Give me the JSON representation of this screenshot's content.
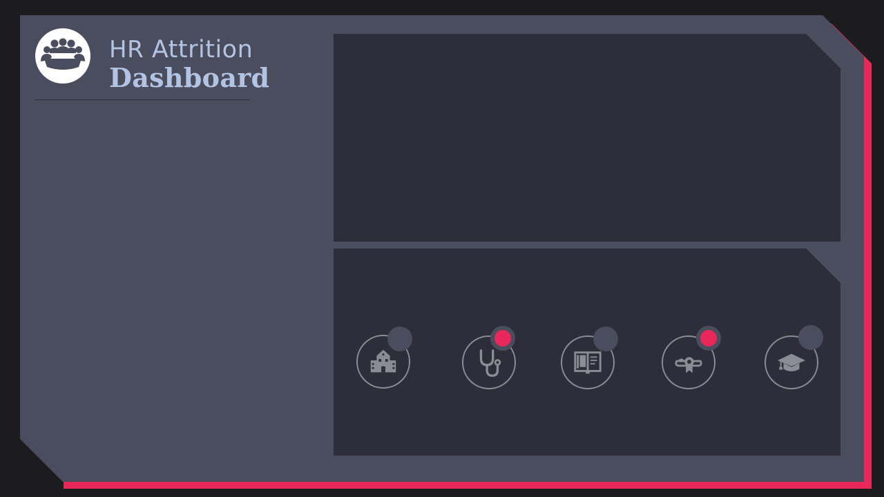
{
  "header": {
    "title_part1": "HR",
    "title_part2": "Attrition",
    "title_line2": "Dashboard",
    "logo_icon": "team-meeting-icon"
  },
  "colors": {
    "background": "#1c1c1e",
    "panel": "#4a4d5e",
    "card": "#2d2e3a",
    "accent": "#e8275a",
    "title": "#b3c3e2",
    "icon": "#8c8c95"
  },
  "education_filters": [
    {
      "id": "school",
      "icon": "school-building-icon",
      "selected": false
    },
    {
      "id": "medical",
      "icon": "stethoscope-icon",
      "selected": true
    },
    {
      "id": "book",
      "icon": "open-book-icon",
      "selected": false
    },
    {
      "id": "diploma",
      "icon": "diploma-scroll-icon",
      "selected": true
    },
    {
      "id": "graduate",
      "icon": "graduation-cap-icon",
      "selected": false
    }
  ]
}
